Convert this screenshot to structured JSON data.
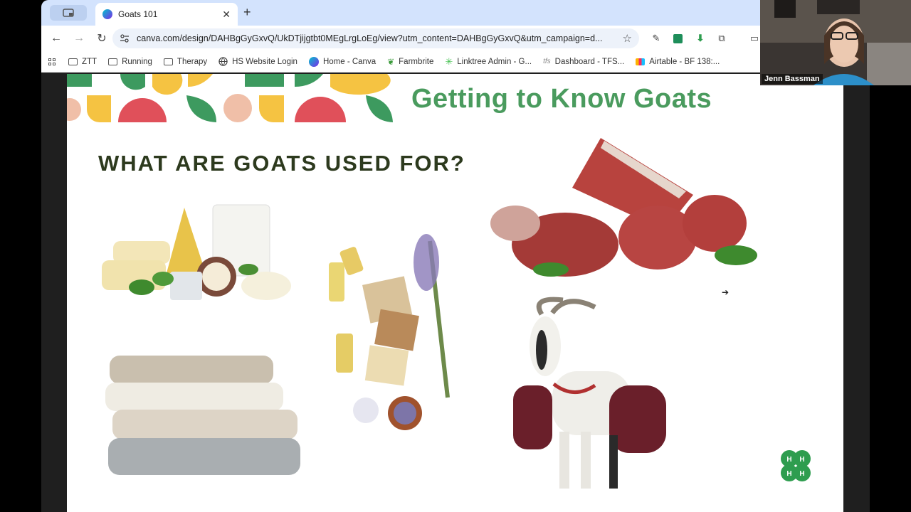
{
  "browser": {
    "tab_title": "Goats 101",
    "url": "canva.com/design/DAHBgGyGxvQ/UkDTjijgtbt0MEgLrgLoEg/view?utm_content=DAHBgGyGxvQ&utm_campaign=d...",
    "bookmarks": [
      {
        "label": "ZTT",
        "icon": "folder-icon"
      },
      {
        "label": "Running",
        "icon": "folder-icon"
      },
      {
        "label": "Therapy",
        "icon": "folder-icon"
      },
      {
        "label": "HS Website Login",
        "icon": "globe-icon"
      },
      {
        "label": "Home - Canva",
        "icon": "canva-icon"
      },
      {
        "label": "Farmbrite",
        "icon": "leaf-icon"
      },
      {
        "label": "Linktree Admin - G...",
        "icon": "linktree-icon"
      },
      {
        "label": "Dashboard - TFS...",
        "icon": "tfs-icon"
      },
      {
        "label": "Airtable - BF 138:...",
        "icon": "airtable-icon"
      }
    ]
  },
  "slide": {
    "title": "Getting to Know Goats",
    "heading": "WHAT ARE GOATS USED FOR?",
    "images": [
      "cheese-and-milk",
      "essential-oils-soap-lavender",
      "raw-goat-meat",
      "knit-sweaters",
      "pack-goat"
    ]
  },
  "webcam": {
    "name": "Jenn Bassman"
  },
  "colors": {
    "title_green": "#4a9b5e",
    "heading_dark": "#2d3a1e",
    "tabstrip": "#d3e3fd",
    "pattern_red": "#e0505a",
    "pattern_yellow": "#f5c342",
    "pattern_green": "#3d9a5f",
    "pattern_peach": "#f0bfa8"
  }
}
